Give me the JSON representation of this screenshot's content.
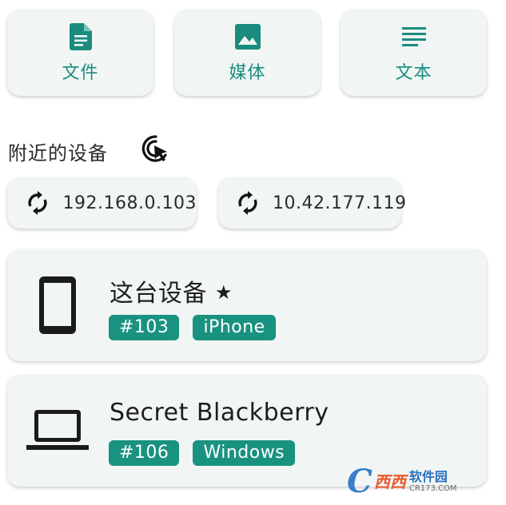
{
  "send_types": [
    {
      "label": "文件",
      "icon": "file-icon"
    },
    {
      "label": "媒体",
      "icon": "image-icon"
    },
    {
      "label": "文本",
      "icon": "text-icon"
    }
  ],
  "nearby": {
    "title": "附近的设备",
    "scan_icon": "scan-cursor-icon"
  },
  "ips": [
    {
      "address": "192.168.0.103",
      "icon": "sync-icon"
    },
    {
      "address": "10.42.177.119",
      "icon": "sync-icon"
    }
  ],
  "devices": [
    {
      "name": "这台设备",
      "star": "★",
      "tags": [
        "#103",
        "iPhone"
      ],
      "icon": "phone-icon"
    },
    {
      "name": "Secret Blackberry",
      "tags": [
        "#106",
        "Windows"
      ],
      "icon": "laptop-icon"
    }
  ],
  "watermark": {
    "brand_cn": "西西",
    "soft_cn": "软件园",
    "url": "CR173.COM",
    "letter": "C"
  },
  "colors": {
    "accent": "#1a8c7e",
    "tag_bg": "#1a9280",
    "card_bg": "#f1f6f5"
  }
}
